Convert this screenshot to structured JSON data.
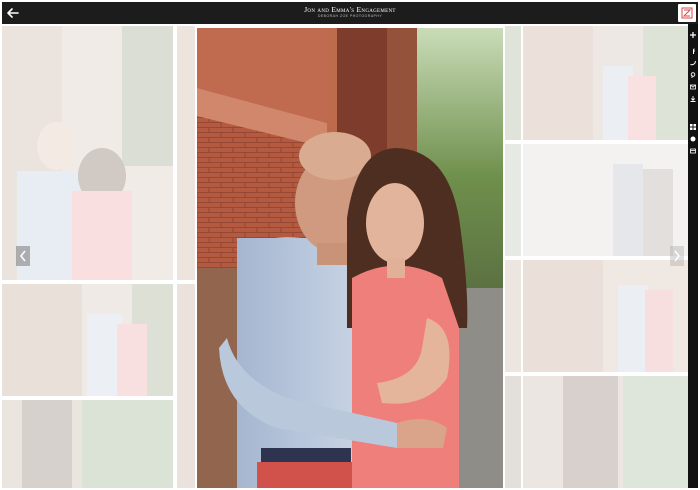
{
  "header": {
    "title": "Jon and Emma's Engagement",
    "subtitle": "DEBORAH ZOE PHOTOGRAPHY",
    "back_icon": "back-arrow-icon",
    "logo_icon": "photographer-logo-icon"
  },
  "rail": {
    "icons": [
      "plus-icon",
      "facebook-icon",
      "twitter-icon",
      "pinterest-icon",
      "email-icon",
      "download-icon",
      "grid-icon",
      "slideshow-icon",
      "cart-icon"
    ]
  },
  "gallery": {
    "prev_icon": "chevron-left-icon",
    "next_icon": "chevron-right-icon"
  },
  "colors": {
    "topbar": "#1c1c1c",
    "rail": "#111111",
    "accent": "#d94a4a"
  }
}
